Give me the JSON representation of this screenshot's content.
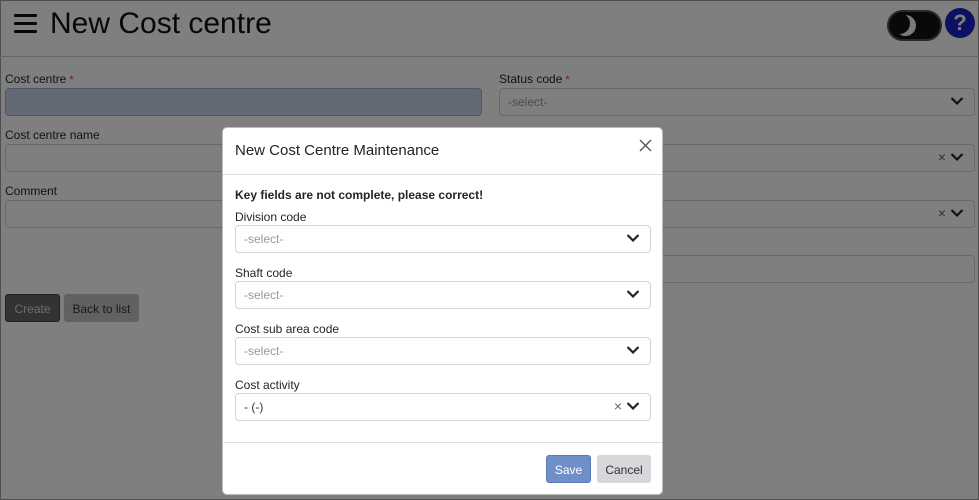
{
  "page": {
    "title": "New Cost centre",
    "menu_icon": "hamburger-menu-icon",
    "theme_icon": "moon-icon",
    "help_label": "?"
  },
  "form": {
    "cost_centre_label": "Cost centre",
    "cost_centre_value": "",
    "required_marker": "*",
    "status_code_label": "Status code",
    "status_code_placeholder": "-select-",
    "cost_centre_name_label": "Cost centre name",
    "cost_centre_name_value": "",
    "comment_label": "Comment",
    "comment_value": "",
    "create_label": "Create",
    "back_label": "Back to list"
  },
  "modal": {
    "title": "New Cost Centre Maintenance",
    "error": "Key fields are not complete, please correct!",
    "division_label": "Division code",
    "division_placeholder": "-select-",
    "shaft_label": "Shaft code",
    "shaft_placeholder": "-select-",
    "subarea_label": "Cost sub area code",
    "subarea_placeholder": "-select-",
    "activity_label": "Cost activity",
    "activity_value": "- (-)",
    "clear_glyph": "×",
    "save_label": "Save",
    "cancel_label": "Cancel"
  }
}
